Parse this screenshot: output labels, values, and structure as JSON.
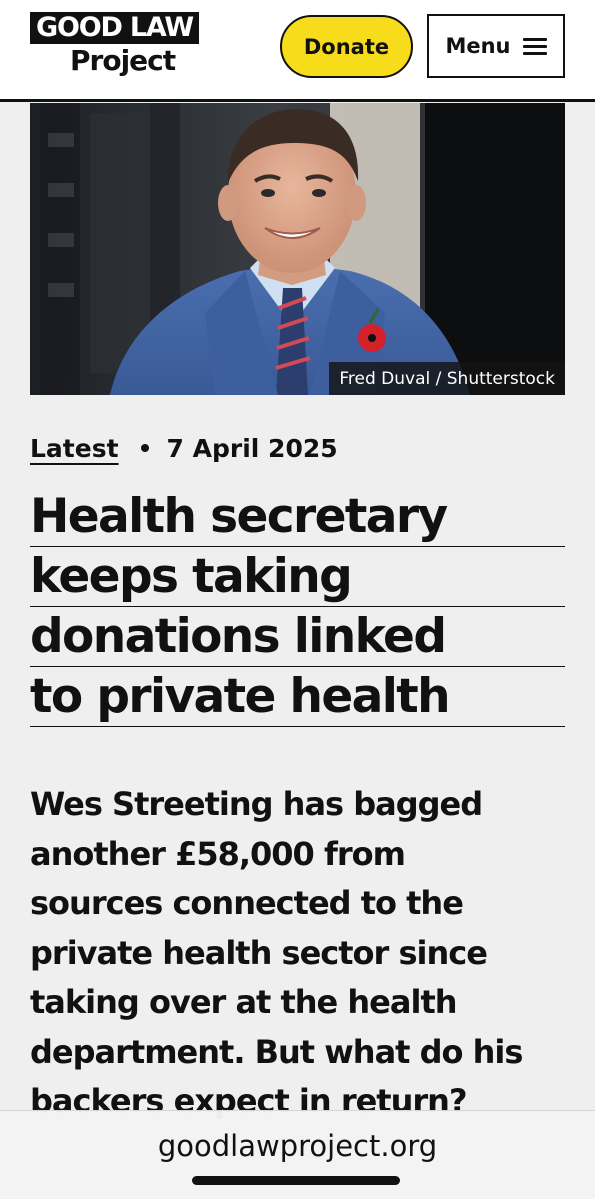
{
  "header": {
    "logo_line1": "GOOD LAW",
    "logo_line2": "Project",
    "donate_label": "Donate",
    "menu_label": "Menu"
  },
  "hero": {
    "credit": "Fred Duval / Shutterstock"
  },
  "article": {
    "category": "Latest",
    "date": "7 April 2025",
    "headline_lines": [
      "Health secretary",
      "keeps taking",
      "donations linked",
      "to private health"
    ],
    "standfirst_lines": [
      "Wes Streeting has bagged",
      "another £58,000 from",
      "sources connected to the",
      "private health sector since",
      "taking over at the health",
      "department. But what do his",
      "backers expect in return?"
    ]
  },
  "browser": {
    "url": "goodlawproject.org"
  },
  "colors": {
    "donate_yellow": "#f7dc1b",
    "background": "#f0efef",
    "ink": "#111111"
  }
}
